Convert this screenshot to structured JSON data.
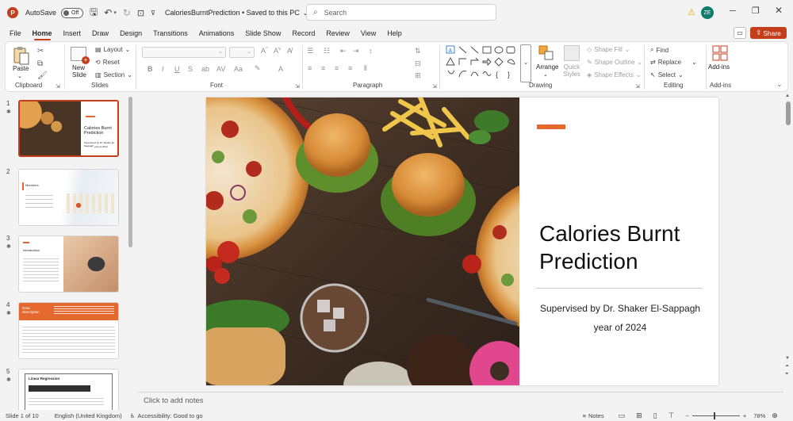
{
  "titlebar": {
    "autosave_label": "AutoSave",
    "autosave_state": "Off",
    "document_title": "CaloriesBurntPrediction • Saved to this PC",
    "search_placeholder": "Search",
    "avatar_initials": "ZE"
  },
  "menu": {
    "tabs": [
      "File",
      "Home",
      "Insert",
      "Draw",
      "Design",
      "Transitions",
      "Animations",
      "Slide Show",
      "Record",
      "Review",
      "View",
      "Help"
    ],
    "active_tab": "Home",
    "share_label": "Share"
  },
  "ribbon": {
    "clipboard": {
      "paste": "Paste",
      "label": "Clipboard"
    },
    "slides": {
      "new_slide": "New Slide",
      "layout": "Layout",
      "reset": "Reset",
      "section": "Section",
      "label": "Slides"
    },
    "font": {
      "label": "Font"
    },
    "paragraph": {
      "label": "Paragraph"
    },
    "drawing": {
      "arrange": "Arrange",
      "quick_styles": "Quick Styles",
      "shape_fill": "Shape Fill",
      "shape_outline": "Shape Outline",
      "shape_effects": "Shape Effects",
      "label": "Drawing"
    },
    "editing": {
      "find": "Find",
      "replace": "Replace",
      "select": "Select",
      "label": "Editing"
    },
    "addins": {
      "addins": "Add-ins",
      "label": "Add-ins"
    }
  },
  "thumbnails": [
    {
      "num": "1",
      "title": "Calories Burnt Prediction",
      "sub": "Supervised by Dr. Shaker El-Sappagh",
      "sub2": "year of 2024"
    },
    {
      "num": "2",
      "title": "Members"
    },
    {
      "num": "3",
      "title": "Introduction"
    },
    {
      "num": "4",
      "title": "Data description"
    },
    {
      "num": "5",
      "title": "Linear Regression"
    }
  ],
  "slide": {
    "title_line1": "Calories Burnt",
    "title_line2": "Prediction",
    "supervisor": "Supervised by Dr. Shaker El-Sappagh",
    "year": "year of 2024",
    "accent_color": "#e5682e"
  },
  "notes_placeholder": "Click to add notes",
  "status": {
    "slide_count": "Slide 1 of 10",
    "language": "English (United Kingdom)",
    "accessibility": "Accessibility: Good to go",
    "notes": "Notes",
    "zoom": "78%"
  }
}
